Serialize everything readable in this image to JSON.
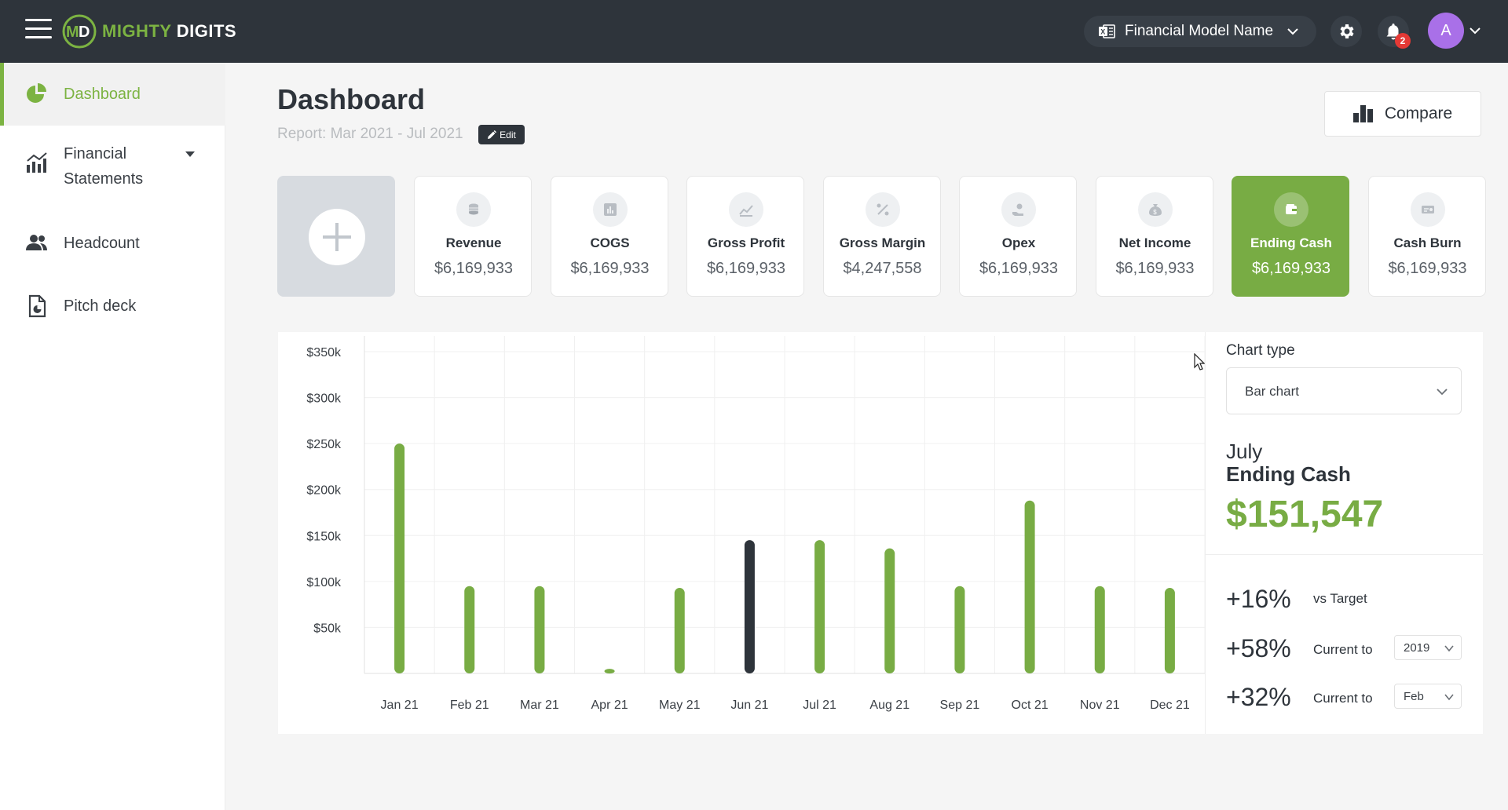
{
  "app": {
    "brand_part1": "MIGHTY",
    "brand_part2": " DIGITS",
    "model_name": "Financial Model Name",
    "notification_count": "2",
    "avatar_initial": "A"
  },
  "sidebar": {
    "items": [
      {
        "label": "Dashboard",
        "icon": "pie-chart-icon"
      },
      {
        "label": "Financial\nStatements",
        "icon": "bar-chart-icon"
      },
      {
        "label": "Headcount",
        "icon": "people-icon"
      },
      {
        "label": "Pitch deck",
        "icon": "document-icon"
      }
    ]
  },
  "header": {
    "title": "Dashboard",
    "report_range": "Report: Mar 2021 - Jul 2021",
    "edit_label": "Edit",
    "compare_label": "Compare"
  },
  "cards": [
    {
      "name": "Revenue",
      "value": "$6,169,933",
      "icon": "coins-icon"
    },
    {
      "name": "COGS",
      "value": "$6,169,933",
      "icon": "chart-square-icon"
    },
    {
      "name": "Gross Profit",
      "value": "$6,169,933",
      "icon": "trend-icon"
    },
    {
      "name": "Gross Margin",
      "value": "$4,247,558",
      "icon": "percent-icon"
    },
    {
      "name": "Opex",
      "value": "$6,169,933",
      "icon": "hand-coin-icon"
    },
    {
      "name": "Net Income",
      "value": "$6,169,933",
      "icon": "money-bag-icon"
    },
    {
      "name": "Ending Cash",
      "value": "$6,169,933",
      "icon": "wallet-icon",
      "active": true
    },
    {
      "name": "Cash Burn",
      "value": "$6,169,933",
      "icon": "bill-icon"
    }
  ],
  "panel": {
    "chart_type_label": "Chart type",
    "chart_type_value": "Bar chart",
    "month": "July",
    "metric": "Ending Cash",
    "value": "$151,547",
    "comparisons": [
      {
        "pct": "+16%",
        "label": "vs Target",
        "select": null
      },
      {
        "pct": "+58%",
        "label": "Current to",
        "select": "2019"
      },
      {
        "pct": "+32%",
        "label": "Current to",
        "select": "Feb"
      }
    ]
  },
  "colors": {
    "accent_green": "#78ac44",
    "highlight_dark": "#2e343b",
    "topbar": "#2e343b"
  },
  "chart_data": {
    "type": "bar",
    "categories": [
      "Jan 21",
      "Feb 21",
      "Mar 21",
      "Apr 21",
      "May 21",
      "Jun 21",
      "Jul 21",
      "Aug 21",
      "Sep 21",
      "Oct 21",
      "Nov 21",
      "Dec 21"
    ],
    "values": [
      250000,
      95000,
      95000,
      5000,
      93000,
      145000,
      145000,
      136000,
      95000,
      188000,
      95000,
      93000
    ],
    "highlighted_category": "Jun 21",
    "y_ticks": [
      "$50k",
      "$100k",
      "$150k",
      "$200k",
      "$250k",
      "$300k",
      "$350k"
    ],
    "ylim": [
      0,
      350000
    ],
    "grid": true
  }
}
